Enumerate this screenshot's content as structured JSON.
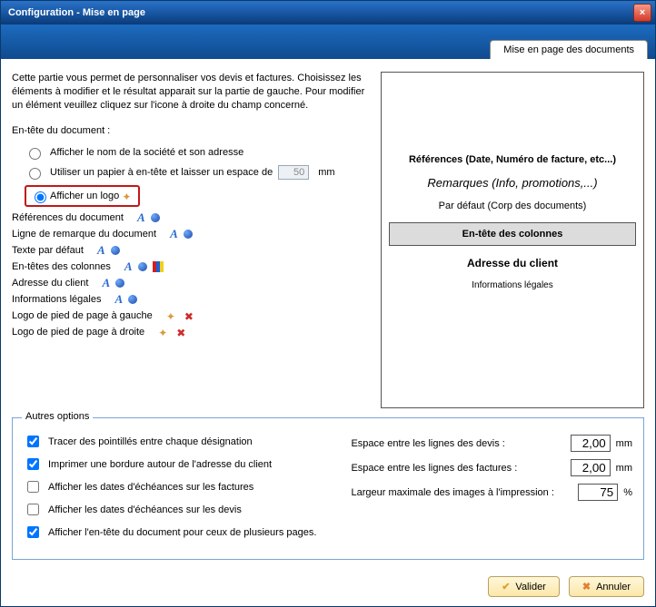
{
  "titlebar": {
    "title": "Configuration - Mise en page"
  },
  "tab": {
    "label": "Mise en page des documents"
  },
  "intro": "Cette partie vous permet de personnaliser vos devis et factures. Choisissez les éléments à modifier et le résultat apparait sur la partie de gauche. Pour modifier un élément veuillez cliquez sur l'icone à droite du champ concerné.",
  "header_section": {
    "label": "En-tête du document :",
    "radio1": "Afficher le nom de la société et son adresse",
    "radio2": "Utiliser un papier à en-tête et laisser un espace de",
    "radio2_value": "50",
    "radio2_unit": "mm",
    "radio3": "Afficher un logo"
  },
  "items": {
    "refs": "Références du document",
    "remark": "Ligne de remarque du document",
    "deftext": "Texte par défaut",
    "colheads": "En-têtes des colonnes",
    "addr": "Adresse du client",
    "legal": "Informations légales",
    "footleft": "Logo de pied de page à gauche",
    "footright": "Logo de pied de page à droite"
  },
  "preview": {
    "refs": "Références (Date, Numéro de facture, etc...)",
    "remarks": "Remarques (Info, promotions,...)",
    "defbody": "Par défaut (Corp des documents)",
    "colhead": "En-tête des colonnes",
    "addr": "Adresse du client",
    "legal": "Informations légales"
  },
  "options": {
    "legend": "Autres options",
    "chk1": "Tracer des pointillés entre chaque désignation",
    "chk2": "Imprimer une bordure autour de l'adresse du client",
    "chk3": "Afficher les dates d'échéances sur les factures",
    "chk4": "Afficher les dates d'échéances sur les devis",
    "chk5": "Afficher l'en-tête du document pour ceux de plusieurs pages.",
    "r1_label": "Espace entre les lignes des devis :",
    "r1_value": "2,00",
    "r1_unit": "mm",
    "r2_label": "Espace entre les lignes des factures :",
    "r2_value": "2,00",
    "r2_unit": "mm",
    "r3_label": "Largeur maximale des images à l'impression :",
    "r3_value": "75",
    "r3_unit": "%"
  },
  "buttons": {
    "ok": "Valider",
    "cancel": "Annuler"
  }
}
